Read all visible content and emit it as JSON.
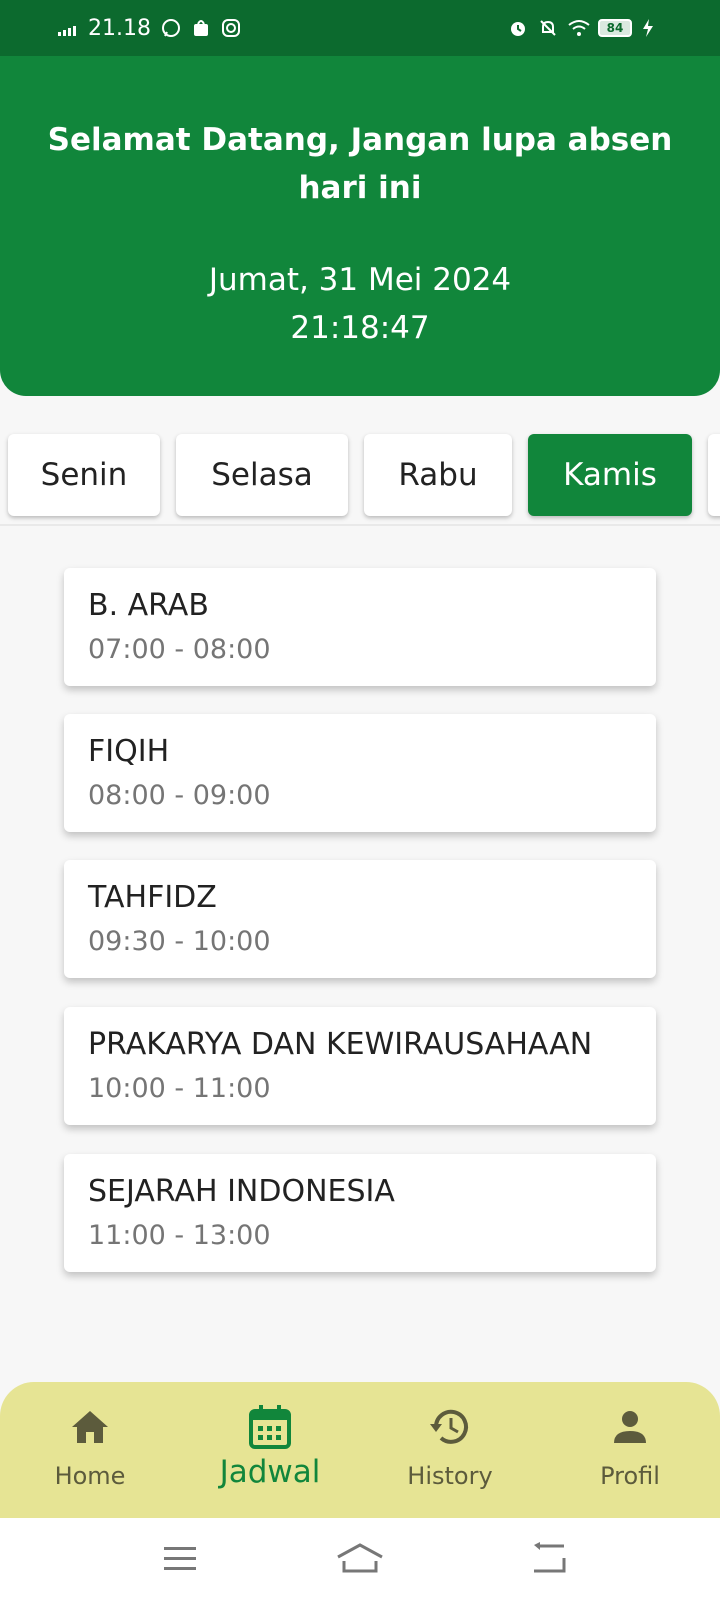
{
  "status_bar": {
    "time": "21.18",
    "battery": "84"
  },
  "header": {
    "welcome": "Selamat Datang, Jangan lupa absen hari ini",
    "date": "Jumat, 31 Mei 2024",
    "time": "21:18:47"
  },
  "days": {
    "items": [
      {
        "label": "Senin"
      },
      {
        "label": "Selasa"
      },
      {
        "label": "Rabu"
      },
      {
        "label": "Kamis"
      }
    ],
    "selected": "Kamis"
  },
  "schedule": [
    {
      "subject": "B. ARAB",
      "time": "07:00 - 08:00"
    },
    {
      "subject": "FIQIH",
      "time": "08:00 - 09:00"
    },
    {
      "subject": "TAHFIDZ",
      "time": "09:30 - 10:00"
    },
    {
      "subject": "PRAKARYA DAN KEWIRAUSAHAAN",
      "time": "10:00 - 11:00"
    },
    {
      "subject": "SEJARAH INDONESIA",
      "time": "11:00 - 13:00"
    }
  ],
  "nav": {
    "items": [
      {
        "label": "Home",
        "icon": "home-icon"
      },
      {
        "label": "Jadwal",
        "icon": "calendar-icon"
      },
      {
        "label": "History",
        "icon": "history-icon"
      },
      {
        "label": "Profil",
        "icon": "person-icon"
      }
    ],
    "active": "Jadwal"
  },
  "colors": {
    "primary": "#11863b",
    "status_bar": "#0c6a2e",
    "nav_background": "#e6e494",
    "nav_inactive": "#5c5b3c"
  }
}
